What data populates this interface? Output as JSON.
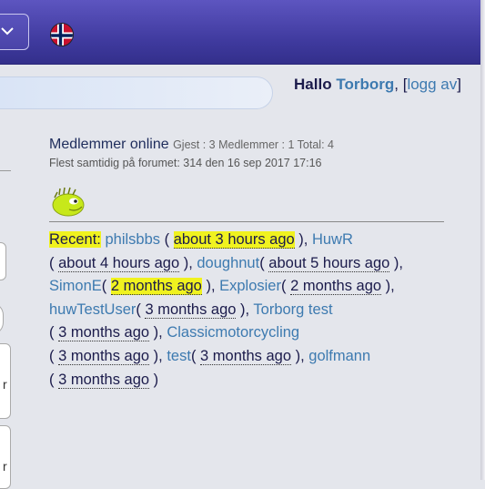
{
  "header": {
    "dropdown_icon": "chevron-down-icon",
    "flag_icon": "norway-flag-icon"
  },
  "greeting": {
    "hello": "Hallo",
    "username": "Torborg",
    "comma": ",",
    "open_bracket": "[",
    "logout": "logg av",
    "close_bracket": "]"
  },
  "online": {
    "title": "Medlemmer online",
    "stats": "Gjest : 3 Medlemmer : 1 Total: 4",
    "record": "Flest samtidig på forumet: 314 den 16 sep 2017 17:16"
  },
  "recent": {
    "label": "Recent:",
    "users": [
      {
        "name": "philsbbs",
        "time": "about 3 hours ago",
        "pre": " ( ",
        "post": " ), "
      },
      {
        "name": "HuwR",
        "time": "about 4 hours ago",
        "pre": " ( ",
        "post": " ), "
      },
      {
        "name": "doughnut",
        "time": "about 5 hours ago",
        "pre": "( ",
        "post": " ), "
      },
      {
        "name": "SimonE",
        "time": "2 months ago",
        "pre": "( ",
        "post": " ), "
      },
      {
        "name": "Explosier",
        "time": "2 months ago",
        "pre": "( ",
        "post": " ), "
      },
      {
        "name": "huwTestUser",
        "time": "3 months ago",
        "pre": "( ",
        "post": " ), "
      },
      {
        "name": "Torborg test",
        "time": "3 months ago",
        "pre": " ( ",
        "post": " ), "
      },
      {
        "name": "Classicmotorcycling",
        "time": "3 months ago",
        "pre": " ( ",
        "post": " ), "
      },
      {
        "name": "test",
        "time": "3 months ago",
        "pre": "( ",
        "post": " ), "
      },
      {
        "name": "golfmann",
        "time": "3 months ago",
        "pre": " ( ",
        "post": " )"
      }
    ]
  },
  "left_stubs": {
    "stub3_text": "r",
    "stub4_text": "r"
  },
  "colors": {
    "nav": "#4a44a8",
    "link": "#3d7ab0",
    "highlight": "#f0f21f",
    "text": "#1b1b4b"
  }
}
